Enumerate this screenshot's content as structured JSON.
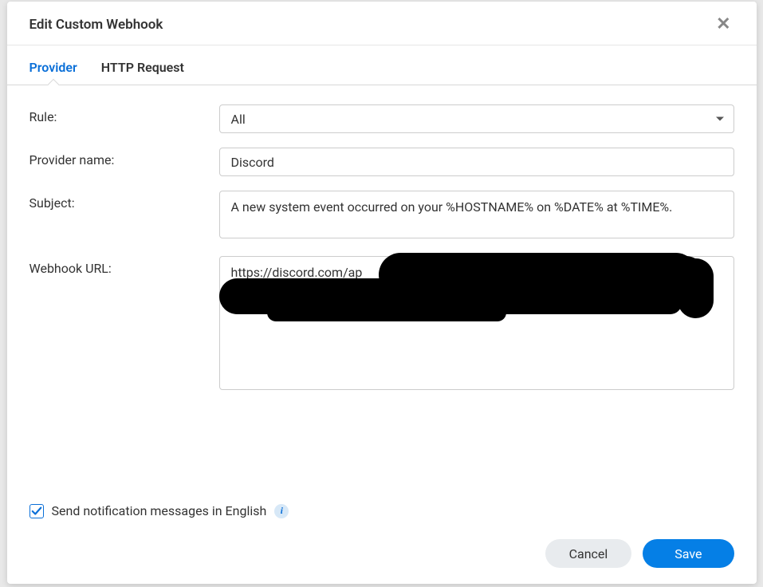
{
  "dialog": {
    "title": "Edit Custom Webhook"
  },
  "tabs": {
    "provider": "Provider",
    "http_request": "HTTP Request"
  },
  "form": {
    "rule": {
      "label": "Rule:",
      "value": "All"
    },
    "provider_name": {
      "label": "Provider name:",
      "value": "Discord"
    },
    "subject": {
      "label": "Subject:",
      "value": "A new system event occurred on your %HOSTNAME% on %DATE% at %TIME%."
    },
    "webhook_url": {
      "label": "Webhook URL:",
      "value": "https://discord.com/ap"
    }
  },
  "checkbox": {
    "label": "Send notification messages in English",
    "checked": true
  },
  "footer": {
    "cancel": "Cancel",
    "save": "Save"
  }
}
